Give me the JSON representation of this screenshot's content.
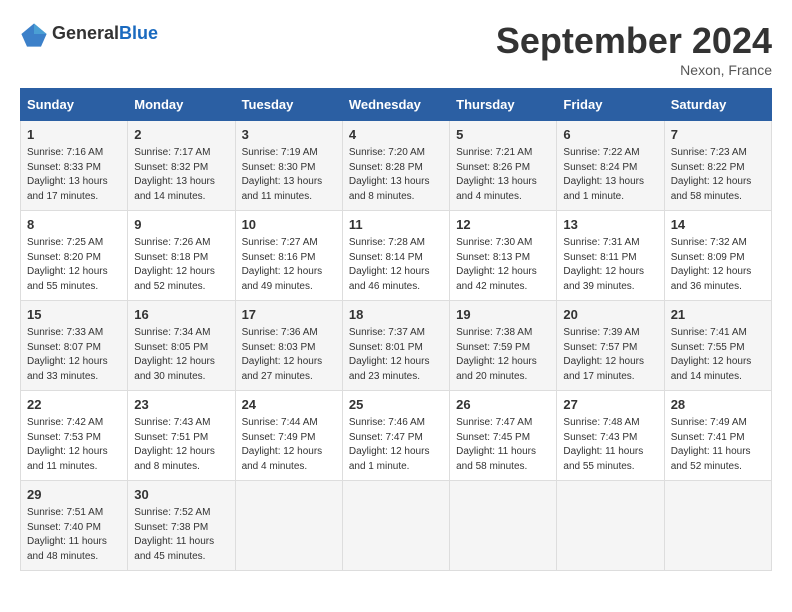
{
  "header": {
    "logo_general": "General",
    "logo_blue": "Blue",
    "month": "September 2024",
    "location": "Nexon, France"
  },
  "days_of_week": [
    "Sunday",
    "Monday",
    "Tuesday",
    "Wednesday",
    "Thursday",
    "Friday",
    "Saturday"
  ],
  "weeks": [
    [
      {
        "day": "1",
        "info": "Sunrise: 7:16 AM\nSunset: 8:33 PM\nDaylight: 13 hours and 17 minutes."
      },
      {
        "day": "2",
        "info": "Sunrise: 7:17 AM\nSunset: 8:32 PM\nDaylight: 13 hours and 14 minutes."
      },
      {
        "day": "3",
        "info": "Sunrise: 7:19 AM\nSunset: 8:30 PM\nDaylight: 13 hours and 11 minutes."
      },
      {
        "day": "4",
        "info": "Sunrise: 7:20 AM\nSunset: 8:28 PM\nDaylight: 13 hours and 8 minutes."
      },
      {
        "day": "5",
        "info": "Sunrise: 7:21 AM\nSunset: 8:26 PM\nDaylight: 13 hours and 4 minutes."
      },
      {
        "day": "6",
        "info": "Sunrise: 7:22 AM\nSunset: 8:24 PM\nDaylight: 13 hours and 1 minute."
      },
      {
        "day": "7",
        "info": "Sunrise: 7:23 AM\nSunset: 8:22 PM\nDaylight: 12 hours and 58 minutes."
      }
    ],
    [
      {
        "day": "8",
        "info": "Sunrise: 7:25 AM\nSunset: 8:20 PM\nDaylight: 12 hours and 55 minutes."
      },
      {
        "day": "9",
        "info": "Sunrise: 7:26 AM\nSunset: 8:18 PM\nDaylight: 12 hours and 52 minutes."
      },
      {
        "day": "10",
        "info": "Sunrise: 7:27 AM\nSunset: 8:16 PM\nDaylight: 12 hours and 49 minutes."
      },
      {
        "day": "11",
        "info": "Sunrise: 7:28 AM\nSunset: 8:14 PM\nDaylight: 12 hours and 46 minutes."
      },
      {
        "day": "12",
        "info": "Sunrise: 7:30 AM\nSunset: 8:13 PM\nDaylight: 12 hours and 42 minutes."
      },
      {
        "day": "13",
        "info": "Sunrise: 7:31 AM\nSunset: 8:11 PM\nDaylight: 12 hours and 39 minutes."
      },
      {
        "day": "14",
        "info": "Sunrise: 7:32 AM\nSunset: 8:09 PM\nDaylight: 12 hours and 36 minutes."
      }
    ],
    [
      {
        "day": "15",
        "info": "Sunrise: 7:33 AM\nSunset: 8:07 PM\nDaylight: 12 hours and 33 minutes."
      },
      {
        "day": "16",
        "info": "Sunrise: 7:34 AM\nSunset: 8:05 PM\nDaylight: 12 hours and 30 minutes."
      },
      {
        "day": "17",
        "info": "Sunrise: 7:36 AM\nSunset: 8:03 PM\nDaylight: 12 hours and 27 minutes."
      },
      {
        "day": "18",
        "info": "Sunrise: 7:37 AM\nSunset: 8:01 PM\nDaylight: 12 hours and 23 minutes."
      },
      {
        "day": "19",
        "info": "Sunrise: 7:38 AM\nSunset: 7:59 PM\nDaylight: 12 hours and 20 minutes."
      },
      {
        "day": "20",
        "info": "Sunrise: 7:39 AM\nSunset: 7:57 PM\nDaylight: 12 hours and 17 minutes."
      },
      {
        "day": "21",
        "info": "Sunrise: 7:41 AM\nSunset: 7:55 PM\nDaylight: 12 hours and 14 minutes."
      }
    ],
    [
      {
        "day": "22",
        "info": "Sunrise: 7:42 AM\nSunset: 7:53 PM\nDaylight: 12 hours and 11 minutes."
      },
      {
        "day": "23",
        "info": "Sunrise: 7:43 AM\nSunset: 7:51 PM\nDaylight: 12 hours and 8 minutes."
      },
      {
        "day": "24",
        "info": "Sunrise: 7:44 AM\nSunset: 7:49 PM\nDaylight: 12 hours and 4 minutes."
      },
      {
        "day": "25",
        "info": "Sunrise: 7:46 AM\nSunset: 7:47 PM\nDaylight: 12 hours and 1 minute."
      },
      {
        "day": "26",
        "info": "Sunrise: 7:47 AM\nSunset: 7:45 PM\nDaylight: 11 hours and 58 minutes."
      },
      {
        "day": "27",
        "info": "Sunrise: 7:48 AM\nSunset: 7:43 PM\nDaylight: 11 hours and 55 minutes."
      },
      {
        "day": "28",
        "info": "Sunrise: 7:49 AM\nSunset: 7:41 PM\nDaylight: 11 hours and 52 minutes."
      }
    ],
    [
      {
        "day": "29",
        "info": "Sunrise: 7:51 AM\nSunset: 7:40 PM\nDaylight: 11 hours and 48 minutes."
      },
      {
        "day": "30",
        "info": "Sunrise: 7:52 AM\nSunset: 7:38 PM\nDaylight: 11 hours and 45 minutes."
      },
      {
        "day": "",
        "info": ""
      },
      {
        "day": "",
        "info": ""
      },
      {
        "day": "",
        "info": ""
      },
      {
        "day": "",
        "info": ""
      },
      {
        "day": "",
        "info": ""
      }
    ]
  ]
}
